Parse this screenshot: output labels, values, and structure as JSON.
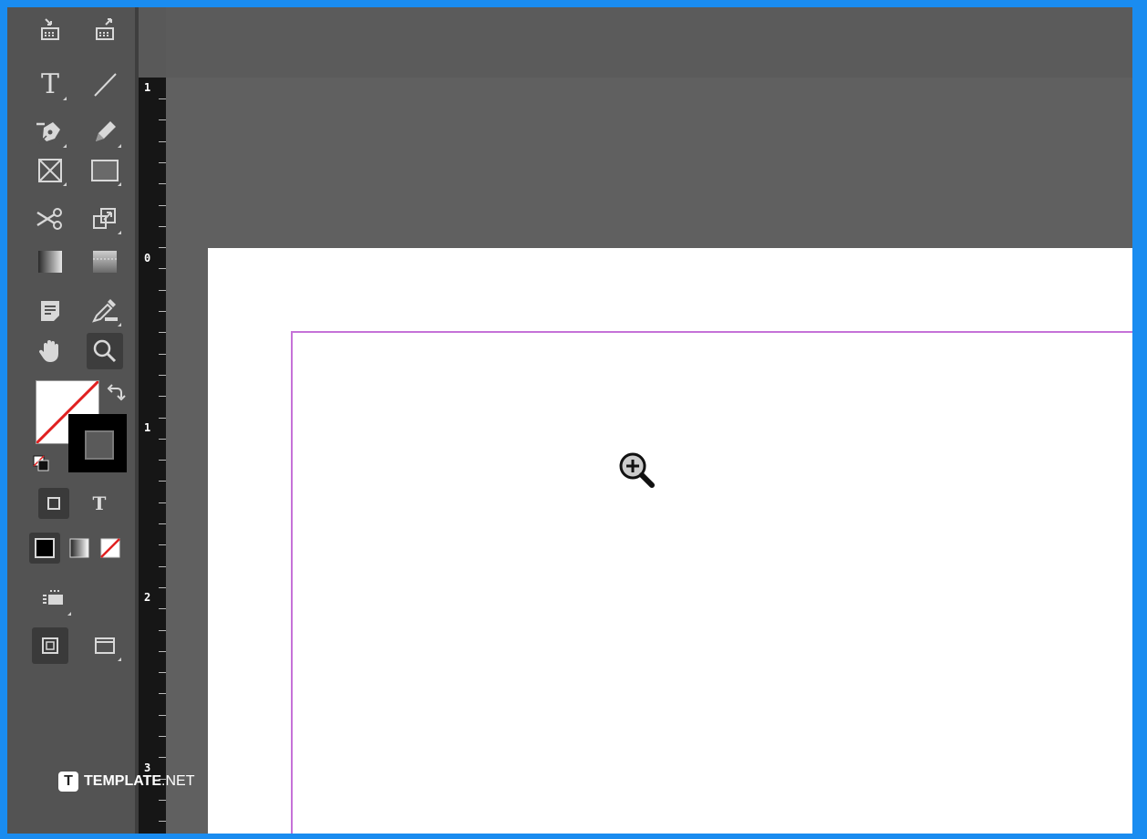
{
  "toolbar": {
    "tools": [
      {
        "name": "content-collector-tool",
        "icon": "content-collector-icon"
      },
      {
        "name": "content-placer-tool",
        "icon": "content-placer-icon"
      },
      {
        "name": "type-tool",
        "icon": "type-icon",
        "glyph": "T"
      },
      {
        "name": "line-tool",
        "icon": "line-icon"
      },
      {
        "name": "pen-tool",
        "icon": "pen-icon"
      },
      {
        "name": "pencil-tool",
        "icon": "pencil-icon"
      },
      {
        "name": "rectangle-frame-tool",
        "icon": "rectangle-frame-icon"
      },
      {
        "name": "rectangle-tool",
        "icon": "rectangle-icon"
      },
      {
        "name": "scissors-tool",
        "icon": "scissors-icon"
      },
      {
        "name": "free-transform-tool",
        "icon": "free-transform-icon"
      },
      {
        "name": "gradient-swatch-tool",
        "icon": "gradient-swatch-icon"
      },
      {
        "name": "gradient-feather-tool",
        "icon": "gradient-feather-icon"
      },
      {
        "name": "note-tool",
        "icon": "note-icon"
      },
      {
        "name": "eyedropper-tool",
        "icon": "eyedropper-icon"
      },
      {
        "name": "hand-tool",
        "icon": "hand-icon"
      },
      {
        "name": "zoom-tool",
        "icon": "zoom-icon",
        "active": true
      }
    ],
    "formatting_text_glyph": "T"
  },
  "colors": {
    "fill": "#ffffff",
    "stroke": "#000000",
    "accent_none": "#e02020",
    "margin_guide": "#c572d8"
  },
  "ruler": {
    "labels": [
      "1",
      "0",
      "1",
      "2",
      "3"
    ]
  },
  "watermark": {
    "brand": "TEMPLATE",
    "tld": ".NET",
    "mark": "T"
  },
  "cursor": {
    "icon": "zoom-in-cursor-icon"
  }
}
